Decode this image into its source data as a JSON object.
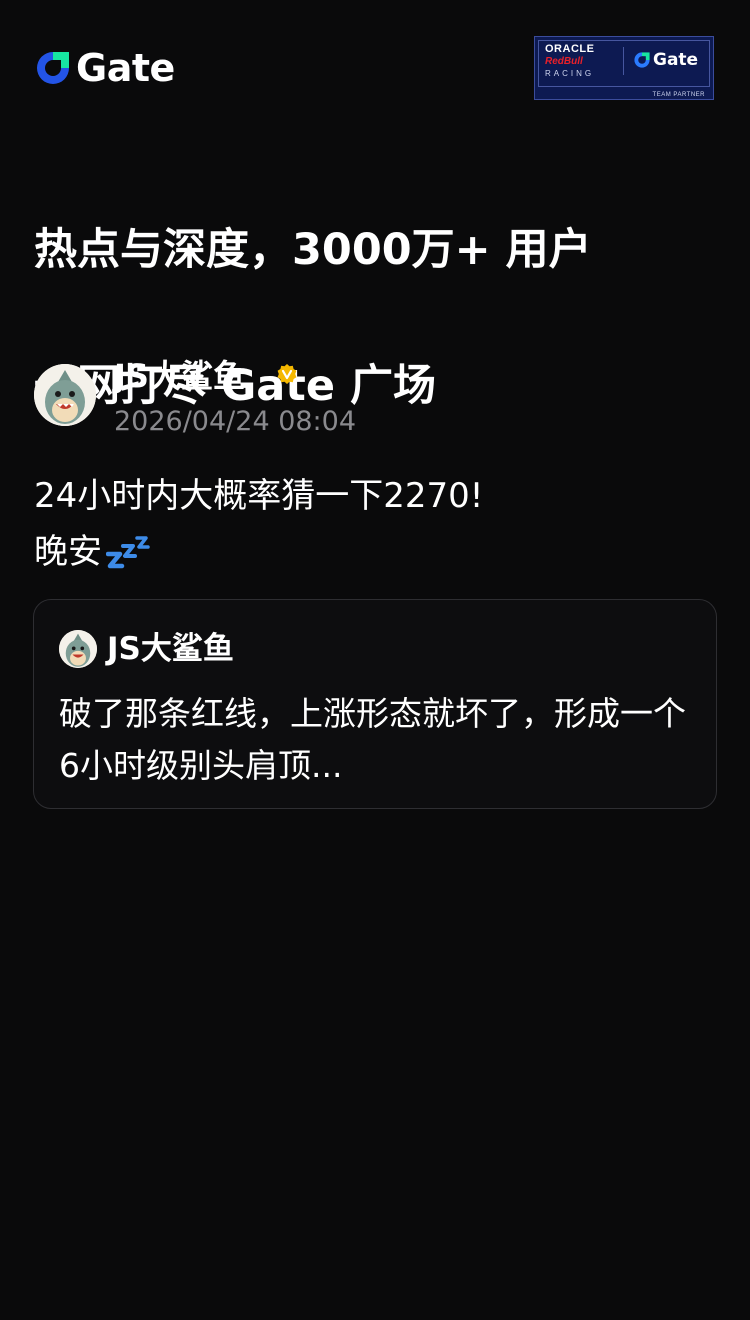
{
  "header": {
    "logo_text": "Gate",
    "partner_badge": {
      "oracle": "ORACLE",
      "redbull": "RedBull",
      "racing": "RACING",
      "gate": "Gate",
      "team_partner": "TEAM PARTNER"
    }
  },
  "headline": {
    "line1": "热点与深度，3000万+ 用户",
    "line2": "一网打尽 Gate 广场"
  },
  "post": {
    "author": "JS大鲨鱼",
    "verified_icon": "verified-badge-icon",
    "timestamp": "2026/04/24 08:04",
    "line1": "24小时内大概率猜一下2270!",
    "line2": "晚安",
    "emoji": "zzz-icon"
  },
  "quote": {
    "author": "JS大鲨鱼",
    "text": "破了那条红线，上涨形态就坏了，形成一个6小时级别头肩顶..."
  },
  "colors": {
    "background": "#0a0a0b",
    "brand_blue": "#2354e6",
    "brand_green": "#17e6a1",
    "verified_gold": "#f5b800",
    "timestamp_gray": "#8a8a8e",
    "card_border": "#2e2e32",
    "zzz_blue": "#3d8be8"
  }
}
